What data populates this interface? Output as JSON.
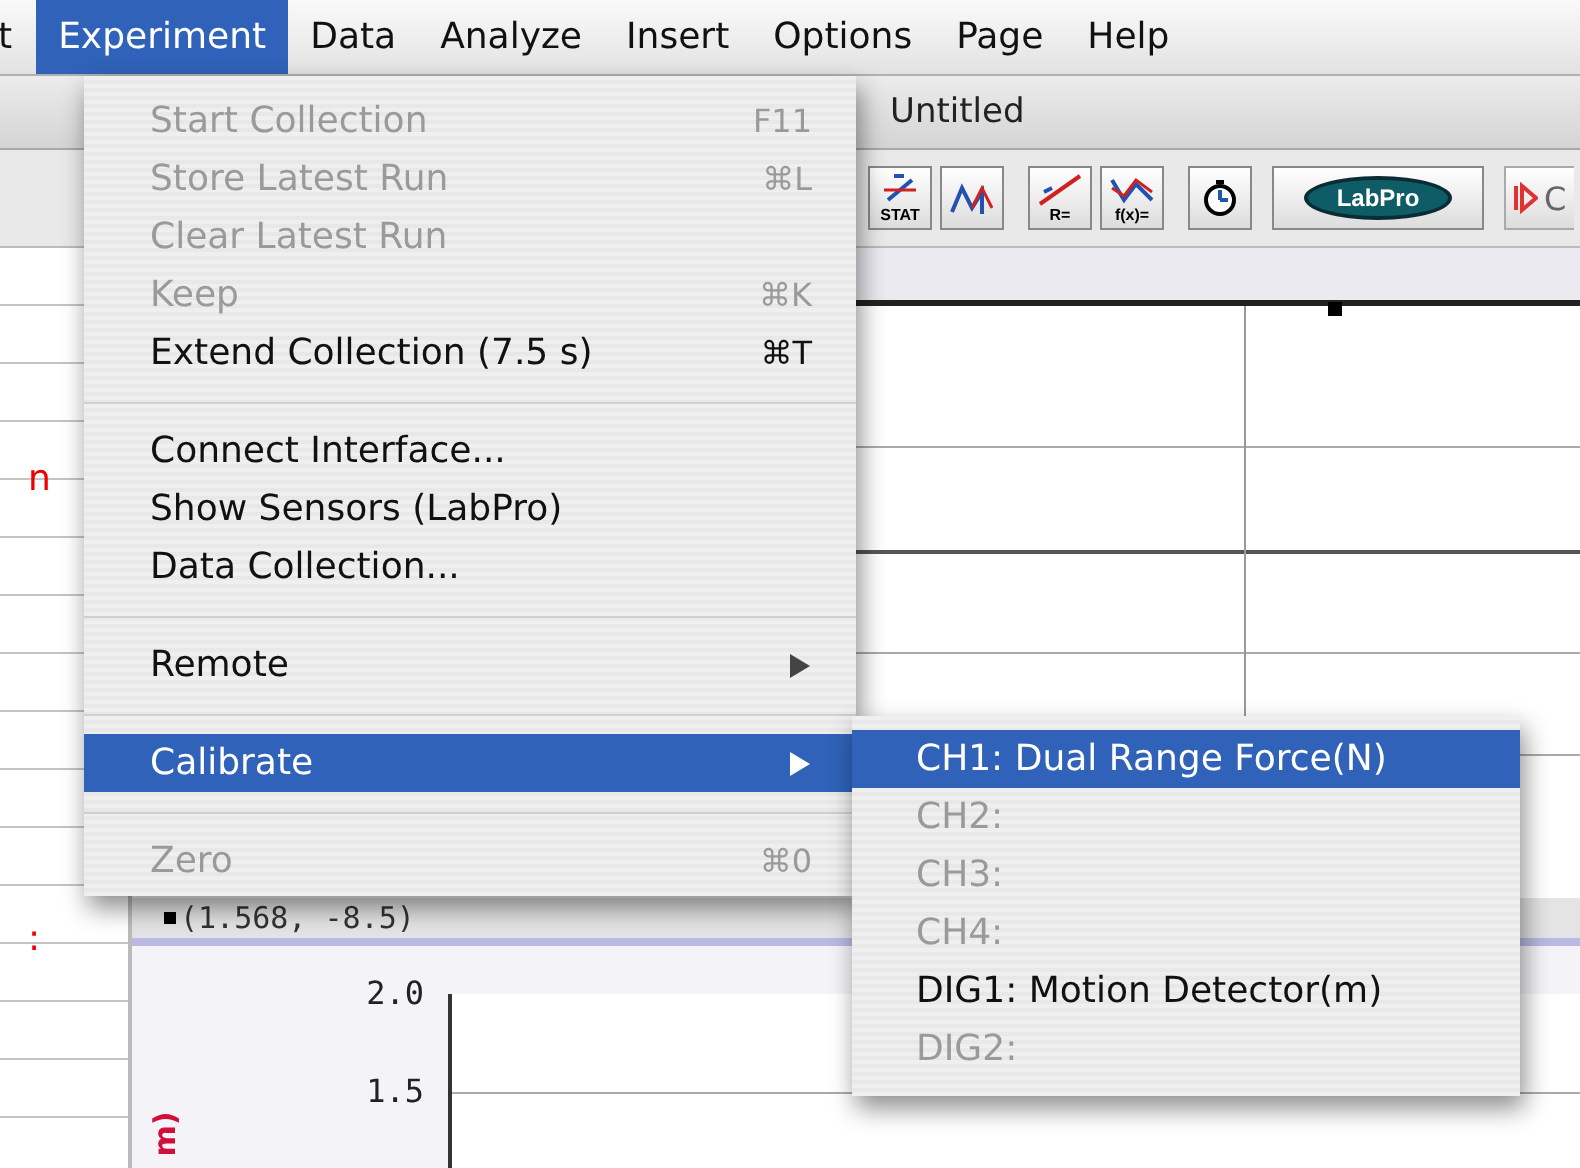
{
  "menubar": [
    {
      "label": "t",
      "selected": false
    },
    {
      "label": "Experiment",
      "selected": true
    },
    {
      "label": "Data",
      "selected": false
    },
    {
      "label": "Analyze",
      "selected": false
    },
    {
      "label": "Insert",
      "selected": false
    },
    {
      "label": "Options",
      "selected": false
    },
    {
      "label": "Page",
      "selected": false
    },
    {
      "label": "Help",
      "selected": false
    }
  ],
  "window": {
    "title": "Untitled"
  },
  "toolbar": [
    {
      "kind": "stat",
      "caption": "STAT"
    },
    {
      "kind": "tangent"
    },
    {
      "kind": "fit",
      "caption": "R="
    },
    {
      "kind": "curve",
      "caption": "f(x)="
    },
    {
      "kind": "timer"
    },
    {
      "kind": "interface",
      "label": "LabPro"
    },
    {
      "kind": "collect",
      "label": "C"
    }
  ],
  "cut_labels": [
    "n",
    ":"
  ],
  "graph_top": {
    "coordinates": "(1.568, -8.5)"
  },
  "graph_bottom": {
    "tick_labels": [
      "2.0",
      "1.5"
    ],
    "axis_label": "m)"
  },
  "menu": {
    "items": [
      {
        "kind": "item",
        "label": "Start Collection",
        "shortcut": "F11",
        "disabled": true,
        "selected": false
      },
      {
        "kind": "item",
        "label": "Store Latest Run",
        "shortcut": "⌘L",
        "disabled": true,
        "selected": false
      },
      {
        "kind": "item",
        "label": "Clear Latest Run",
        "disabled": true,
        "selected": false
      },
      {
        "kind": "item",
        "label": "Keep",
        "shortcut": "⌘K",
        "disabled": true,
        "selected": false
      },
      {
        "kind": "item",
        "label": "Extend Collection (7.5 s)",
        "shortcut": "⌘T",
        "disabled": false,
        "selected": false
      },
      {
        "kind": "separator"
      },
      {
        "kind": "item",
        "label": "Connect Interface...",
        "disabled": false,
        "selected": false
      },
      {
        "kind": "item",
        "label": "Show Sensors (LabPro)",
        "disabled": false,
        "selected": false
      },
      {
        "kind": "item",
        "label": "Data Collection...",
        "disabled": false,
        "selected": false
      },
      {
        "kind": "separator"
      },
      {
        "kind": "item",
        "label": "Remote",
        "submenu": true,
        "disabled": false,
        "selected": false
      },
      {
        "kind": "separator"
      },
      {
        "kind": "item",
        "label": "Calibrate",
        "submenu": true,
        "disabled": false,
        "selected": true
      },
      {
        "kind": "separator"
      },
      {
        "kind": "item",
        "label": "Zero",
        "shortcut": "⌘0",
        "disabled": true,
        "selected": false
      }
    ]
  },
  "submenu": {
    "items": [
      {
        "label": "CH1: Dual Range Force(N)",
        "disabled": false,
        "selected": true
      },
      {
        "label": "CH2:",
        "disabled": true,
        "selected": false
      },
      {
        "label": "CH3:",
        "disabled": true,
        "selected": false
      },
      {
        "label": "CH4:",
        "disabled": true,
        "selected": false
      },
      {
        "label": "DIG1: Motion Detector(m)",
        "disabled": false,
        "selected": false
      },
      {
        "label": "DIG2:",
        "disabled": true,
        "selected": false
      }
    ]
  }
}
